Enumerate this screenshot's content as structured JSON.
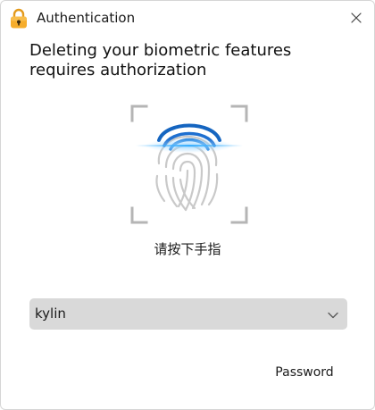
{
  "window": {
    "title": "Authentication",
    "icon": "lock-icon",
    "close_icon": "close-icon"
  },
  "message": {
    "line1": "Deleting your biometric features",
    "line2": "requires authorization"
  },
  "fingerprint": {
    "icon": "fingerprint-icon",
    "accent": "#1a6fd1",
    "frame_color": "#b8b8b8"
  },
  "prompt": "请按下手指",
  "user_select": {
    "value": "kylin",
    "icon": "chevron-down-icon"
  },
  "actions": {
    "password_label": "Password"
  },
  "colors": {
    "select_bg": "#d9d9d9",
    "lock_icon": "#f5a623"
  }
}
